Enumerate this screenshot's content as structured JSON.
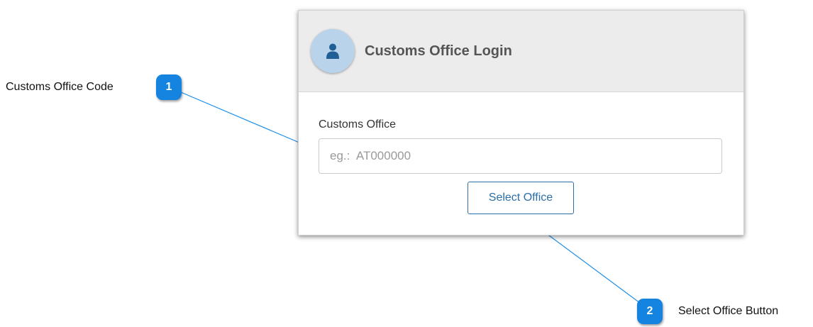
{
  "card": {
    "title": "Customs Office Login",
    "icon": "user-icon",
    "field_label": "Customs Office",
    "input_value": "",
    "input_placeholder": "eg.:  AT000000",
    "button_label": "Select Office"
  },
  "callouts": [
    {
      "number": "1",
      "label": "Customs Office Code"
    },
    {
      "number": "2",
      "label": "Select Office Button"
    }
  ],
  "colors": {
    "accent": "#2b6fa8",
    "badge": "#1583e0",
    "header_bg": "#ececec",
    "avatar_bg": "#b9d3ea"
  }
}
